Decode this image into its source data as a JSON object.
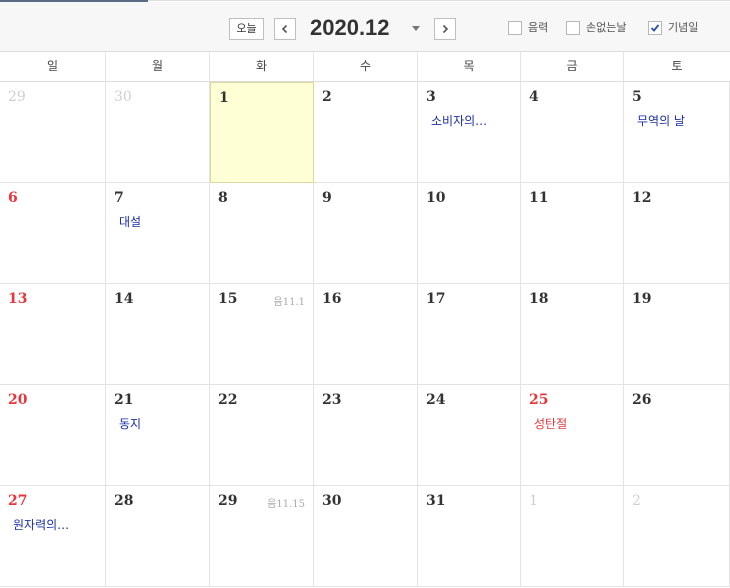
{
  "toolbar": {
    "today_label": "오늘",
    "month_label": "2020.12",
    "options": [
      {
        "label": "음력",
        "checked": false
      },
      {
        "label": "손없는날",
        "checked": false
      },
      {
        "label": "기념일",
        "checked": true
      }
    ]
  },
  "weekdays": [
    "일",
    "월",
    "화",
    "수",
    "목",
    "금",
    "토"
  ],
  "weeks": [
    [
      {
        "day": "29",
        "other": true
      },
      {
        "day": "30",
        "other": true
      },
      {
        "day": "1",
        "today": true
      },
      {
        "day": "2"
      },
      {
        "day": "3",
        "event": "소비자의…"
      },
      {
        "day": "4"
      },
      {
        "day": "5",
        "event": "무역의 날"
      }
    ],
    [
      {
        "day": "6",
        "sun": true
      },
      {
        "day": "7",
        "event": "대설"
      },
      {
        "day": "8"
      },
      {
        "day": "9"
      },
      {
        "day": "10"
      },
      {
        "day": "11"
      },
      {
        "day": "12"
      }
    ],
    [
      {
        "day": "13",
        "sun": true
      },
      {
        "day": "14"
      },
      {
        "day": "15",
        "lunar": "음11.1"
      },
      {
        "day": "16"
      },
      {
        "day": "17"
      },
      {
        "day": "18"
      },
      {
        "day": "19"
      }
    ],
    [
      {
        "day": "20",
        "sun": true
      },
      {
        "day": "21",
        "event": "동지"
      },
      {
        "day": "22"
      },
      {
        "day": "23"
      },
      {
        "day": "24"
      },
      {
        "day": "25",
        "sun": true,
        "event": "성탄절",
        "event_red": true
      },
      {
        "day": "26"
      }
    ],
    [
      {
        "day": "27",
        "sun": true,
        "event": "원자력의…"
      },
      {
        "day": "28"
      },
      {
        "day": "29",
        "lunar": "음11.15"
      },
      {
        "day": "30"
      },
      {
        "day": "31"
      },
      {
        "day": "1",
        "other": true
      },
      {
        "day": "2",
        "other": true
      }
    ]
  ],
  "colors": {
    "sunday": "#e8363c",
    "event": "#1a2ea8",
    "today_bg": "#ffffd6",
    "other_month": "#cfcfcf"
  }
}
